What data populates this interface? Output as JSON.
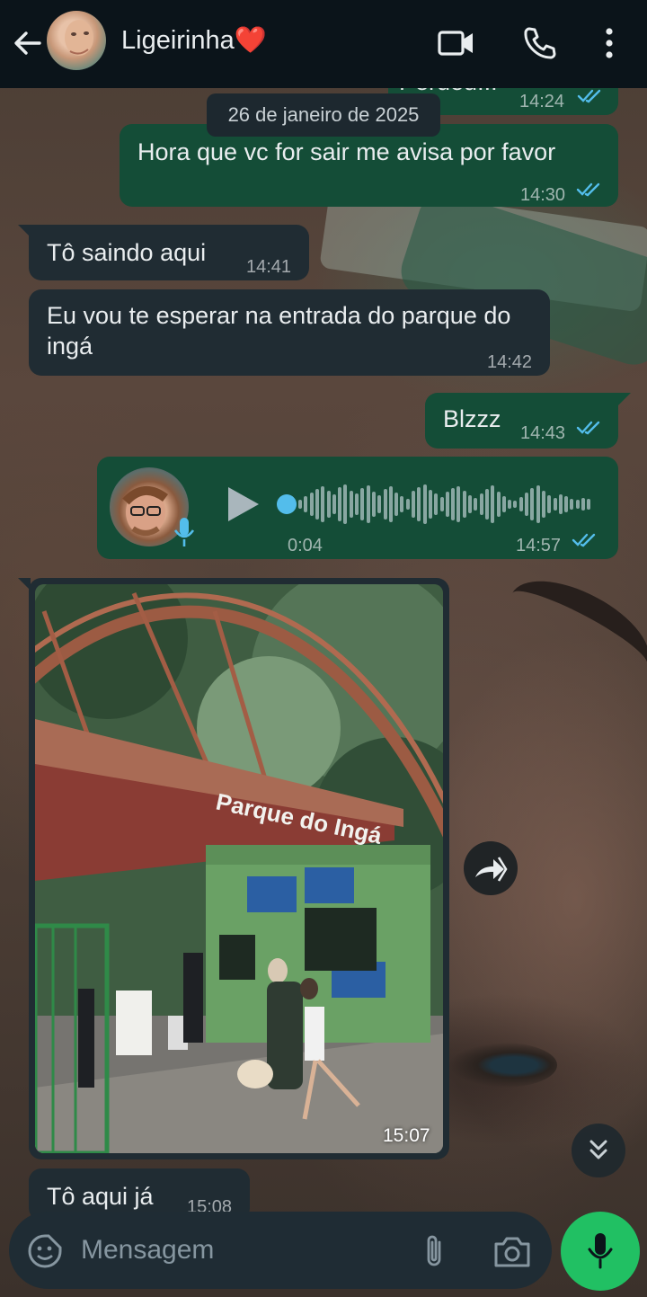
{
  "header": {
    "contact_name": "Ligeirinha❤️",
    "icons": [
      "back-arrow-icon",
      "video-call-icon",
      "phone-icon",
      "more-vert-icon"
    ]
  },
  "chat": {
    "date_chip": "26 de janeiro de 2025",
    "messages": [
      {
        "direction": "out",
        "text": "Perdeu!!!",
        "time": "14:24",
        "status": "read"
      },
      {
        "direction": "out",
        "text": "Hora que vc for sair me avisa por favor",
        "time": "14:30",
        "status": "read"
      },
      {
        "direction": "in",
        "text": "Tô saindo aqui",
        "time": "14:41"
      },
      {
        "direction": "in",
        "text": "Eu vou te esperar na entrada do parque do ingá",
        "time": "14:42"
      },
      {
        "direction": "out",
        "text": "Blzzz",
        "time": "14:43",
        "status": "read"
      },
      {
        "direction": "out",
        "type": "voice",
        "duration": "0:04",
        "time": "14:57",
        "status": "read"
      },
      {
        "direction": "in",
        "type": "image",
        "time": "15:07",
        "sign_text": "Parque do Ingá"
      },
      {
        "direction": "in",
        "text": "Tô aqui já",
        "time": "15:08"
      }
    ]
  },
  "composer": {
    "placeholder": "Mensagem"
  },
  "colors": {
    "header_bg": "#0b141a",
    "outgoing_bubble": "#144d37",
    "incoming_bubble": "#202c33",
    "read_ticks": "#53bdeb",
    "mic_button": "#21c063"
  }
}
